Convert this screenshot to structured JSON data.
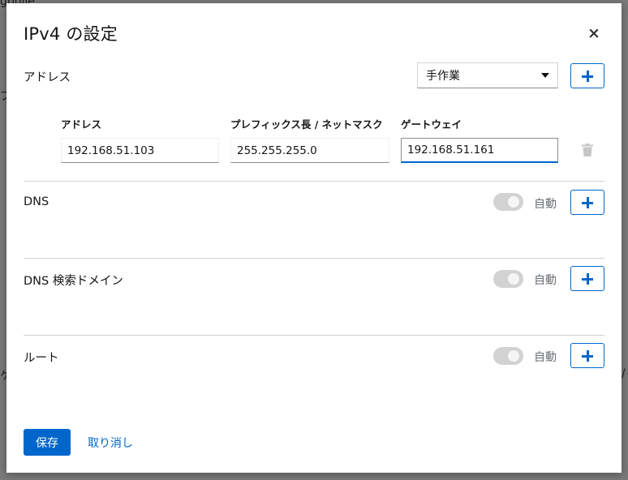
{
  "background": {
    "fragments": [
      "gbulle",
      "ブ",
      "ケ",
      "/"
    ]
  },
  "dialog": {
    "title": "IPv4 の設定",
    "close_label": "×"
  },
  "address": {
    "label": "アドレス",
    "method_selected": "手作業",
    "columns": {
      "address": "アドレス",
      "prefix": "プレフィックス長 / ネットマスク",
      "gateway": "ゲートウェイ"
    },
    "row": {
      "address": "192.168.51.103",
      "prefix": "255.255.255.0",
      "gateway": "192.168.51.161"
    }
  },
  "dns": {
    "label": "DNS",
    "auto_label": "自動"
  },
  "dns_search": {
    "label": "DNS 検索ドメイン",
    "auto_label": "自動"
  },
  "routes": {
    "label": "ルート",
    "auto_label": "自動"
  },
  "footer": {
    "save_label": "保存",
    "cancel_label": "取り消し"
  },
  "colors": {
    "accent": "#0066cc",
    "toggle_off": "#d2d2d2",
    "divider": "#d2d2d2"
  },
  "icons": {
    "close": "close-icon",
    "add": "plus-icon",
    "delete": "trash-icon",
    "dropdown": "caret-down-icon"
  }
}
